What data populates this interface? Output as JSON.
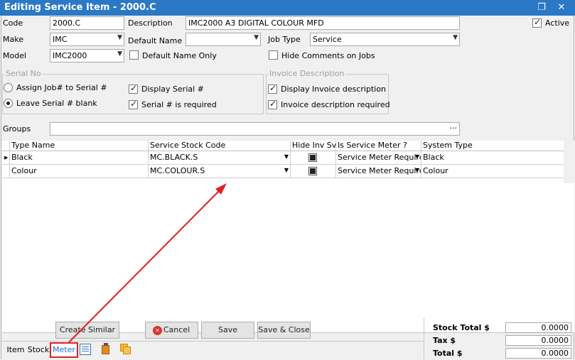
{
  "window": {
    "title": "Editing Service Item - 2000.C",
    "restore_glyph": "❐",
    "close_glyph": "✕"
  },
  "form": {
    "code_label": "Code",
    "code_value": "2000.C",
    "description_label": "Description",
    "description_value": "IMC2000 A3 DIGITAL COLOUR MFD",
    "active_label": "Active",
    "active_checked": true,
    "make_label": "Make",
    "make_value": "IMC",
    "default_name_label": "Default Name",
    "default_name_value": "",
    "job_type_label": "Job Type",
    "job_type_value": "Service",
    "model_label": "Model",
    "model_value": "IMC2000",
    "default_name_only_label": "Default Name Only",
    "hide_comments_label": "Hide Comments on Jobs",
    "groups_label": "Groups",
    "groups_value": "",
    "groups_ellipsis": "···"
  },
  "serial_group": {
    "title": "Serial No",
    "assign_label": "Assign Job# to Serial #",
    "leave_label": "Leave Serial # blank",
    "display_serial_label": "Display Serial #",
    "serial_required_label": "Serial # is required"
  },
  "invoice_group": {
    "title": "Invoice Description",
    "display_label": "Display Invoice description",
    "required_label": "Invoice description required"
  },
  "grid": {
    "headers": [
      "Type Name",
      "Service Stock Code",
      "Hide Inv Svc",
      "Is Service Meter ?",
      "System Type"
    ],
    "rows": [
      {
        "type_name": "Black",
        "stock_code": "MC.BLACK.S",
        "hide_inv": true,
        "meter": "Service Meter Require",
        "system_type": "Black"
      },
      {
        "type_name": "Colour",
        "stock_code": "MC.COLOUR.S",
        "hide_inv": true,
        "meter": "Service Meter Require",
        "system_type": "Colour"
      }
    ]
  },
  "buttons": {
    "create_similar": "Create Similar",
    "cancel": "Cancel",
    "save": "Save",
    "save_close": "Save & Close"
  },
  "tabs": {
    "item": "Item",
    "stock": "Stock",
    "meter": "Meter"
  },
  "totals": {
    "stock_total_label": "Stock Total $",
    "stock_total_value": "0.0000",
    "tax_label": "Tax $",
    "tax_value": "0.0000",
    "total_label": "Total $",
    "total_value": "0.0000"
  },
  "colors": {
    "titlebar": "#2b78c5",
    "annotation": "#e02020",
    "tab_active": "#1e6fd0"
  }
}
